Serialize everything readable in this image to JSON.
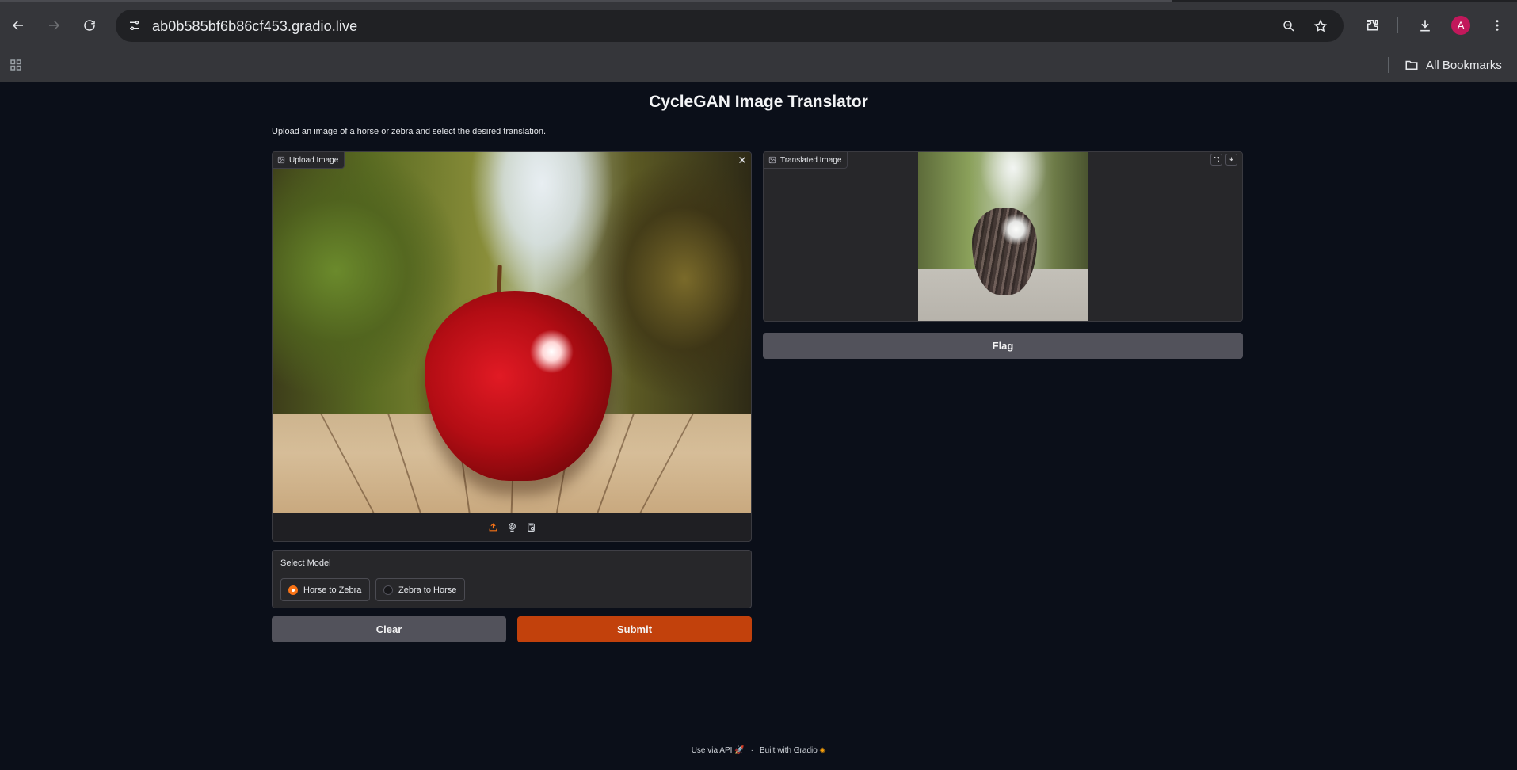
{
  "browser": {
    "url": "ab0b585bf6b86cf453.gradio.live",
    "bookmarks_label": "All Bookmarks",
    "profile_initial": "A"
  },
  "app": {
    "title": "CycleGAN Image Translator",
    "description": "Upload an image of a horse or zebra and select the desired translation.",
    "upload_label": "Upload Image",
    "output_label": "Translated Image",
    "flag_label": "Flag",
    "model": {
      "label": "Select Model",
      "options": [
        "Horse to Zebra",
        "Zebra to Horse"
      ],
      "selected": "Horse to Zebra"
    },
    "clear_label": "Clear",
    "submit_label": "Submit",
    "footer": {
      "api": "Use via API",
      "separator": "·",
      "built": "Built with Gradio"
    }
  },
  "colors": {
    "accent": "#f97316",
    "submit": "#c2410c",
    "background": "#0b0f19"
  }
}
